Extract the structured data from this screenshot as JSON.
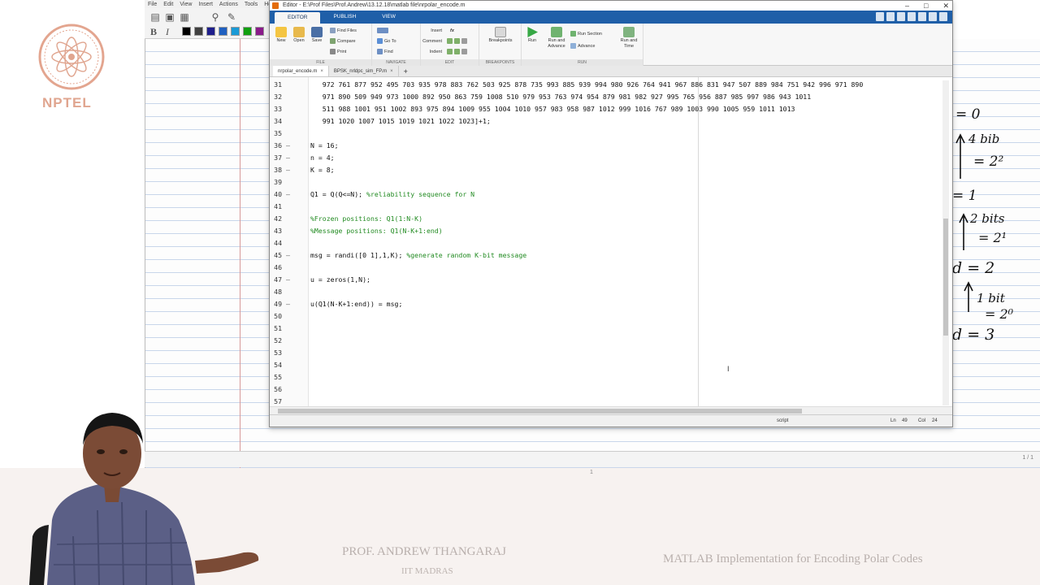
{
  "branding": {
    "logo_text": "NPTEL",
    "logo_color": "#e0a58f"
  },
  "lecture": {
    "professor": "PROF. ANDREW THANGARAJ",
    "institute": "IIT MADRAS",
    "title": "MATLAB Implementation for Encoding Polar Codes"
  },
  "journal": {
    "menu": [
      "File",
      "Edit",
      "View",
      "Insert",
      "Actions",
      "Tools",
      "He"
    ],
    "page_indicator": "1 / 1",
    "center_marker": "1",
    "pen_colors": [
      "#000000",
      "#404040",
      "#1e1e8c",
      "#2060c0",
      "#1a9ad6",
      "#10a010",
      "#8a1a8a"
    ]
  },
  "handwriting": {
    "lines": [
      "= 0",
      "4 bib",
      "= 2²",
      "= 1",
      "2 bits",
      "= 2¹",
      "d = 2",
      "1 bit",
      "= 2⁰",
      "d = 3"
    ]
  },
  "editor": {
    "title": "Editor - E:\\Prof Files\\Prof.Andrew\\13.12.18\\matlab file\\nrpolar_encode.m",
    "window_controls": [
      "–",
      "□",
      "✕"
    ],
    "ribbon_tabs": [
      "EDITOR",
      "PUBLISH",
      "VIEW"
    ],
    "ribbon": {
      "file": {
        "label": "FILE",
        "new": "New",
        "open": "Open",
        "save": "Save",
        "find_files": "Find Files",
        "compare": "Compare",
        "print": "Print"
      },
      "navigate": {
        "label": "NAVIGATE",
        "go_to": "Go To",
        "find": "Find"
      },
      "edit": {
        "label": "EDIT",
        "insert": "Insert",
        "comment": "Comment",
        "indent": "Indent",
        "fx": "fx"
      },
      "breakpoints": {
        "label": "BREAKPOINTS",
        "breakpoints": "Breakpoints"
      },
      "run": {
        "label": "RUN",
        "run": "Run",
        "run_and_advance": "Run and Advance",
        "run_section": "Run Section",
        "advance": "Advance",
        "run_and_time": "Run and Time"
      }
    },
    "file_tabs": [
      {
        "name": "nrpolar_encode.m",
        "active": true
      },
      {
        "name": "BPSK_nrldpc_sim_FP.m",
        "active": false
      }
    ],
    "new_tab": "+",
    "close_glyph": "×",
    "code_lines": [
      {
        "n": "31",
        "marker": "",
        "text": "   972 761 877 952 495 703 935 978 883 762 503 925 878 735 993 885 939 994 980 926 764 941 967 886 831 947 507 889 984 751 942 996 971 890",
        "cls": ""
      },
      {
        "n": "32",
        "marker": "",
        "text": "   971 890 509 949 973 1000 892 950 863 759 1008 510 979 953 763 974 954 879 981 982 927 995 765 956 887 985 997 986 943 1011",
        "cls": ""
      },
      {
        "n": "33",
        "marker": "",
        "text": "   511 988 1001 951 1002 893 975 894 1009 955 1004 1010 957 983 958 987 1012 999 1016 767 989 1003 990 1005 959 1011 1013",
        "cls": ""
      },
      {
        "n": "34",
        "marker": "",
        "text": "   991 1020 1007 1015 1019 1021 1022 1023]+1;",
        "cls": ""
      },
      {
        "n": "35",
        "marker": "",
        "text": "",
        "cls": ""
      },
      {
        "n": "36",
        "marker": "—",
        "text": "N = 16;",
        "cls": ""
      },
      {
        "n": "37",
        "marker": "—",
        "text": "n = 4;",
        "cls": ""
      },
      {
        "n": "38",
        "marker": "—",
        "text": "K = 8;",
        "cls": ""
      },
      {
        "n": "39",
        "marker": "",
        "text": "",
        "cls": ""
      },
      {
        "n": "40",
        "marker": "—",
        "text": "Q1 = Q(Q<=N); ",
        "comment": "%reliability sequence for N",
        "cls": ""
      },
      {
        "n": "41",
        "marker": "",
        "text": "",
        "cls": ""
      },
      {
        "n": "42",
        "marker": "",
        "text": "%Frozen positions: Q1(1:N-K)",
        "cls": "cmt"
      },
      {
        "n": "43",
        "marker": "",
        "text": "%Message positions: Q1(N-K+1:end)",
        "cls": "cmt"
      },
      {
        "n": "44",
        "marker": "",
        "text": "",
        "cls": ""
      },
      {
        "n": "45",
        "marker": "—",
        "text": "msg = randi([0 1],1,K); ",
        "comment": "%generate random K-bit message",
        "cls": ""
      },
      {
        "n": "46",
        "marker": "",
        "text": "",
        "cls": ""
      },
      {
        "n": "47",
        "marker": "—",
        "text": "u = zeros(1,N);",
        "cls": ""
      },
      {
        "n": "48",
        "marker": "",
        "text": "",
        "cls": ""
      },
      {
        "n": "49",
        "marker": "—",
        "text": "u(Q1(N-K+1:end)) = msg;",
        "cls": ""
      },
      {
        "n": "50",
        "marker": "",
        "text": "",
        "cls": ""
      },
      {
        "n": "51",
        "marker": "",
        "text": "",
        "cls": ""
      },
      {
        "n": "52",
        "marker": "",
        "text": "",
        "cls": ""
      },
      {
        "n": "53",
        "marker": "",
        "text": "",
        "cls": ""
      },
      {
        "n": "54",
        "marker": "",
        "text": "",
        "cls": ""
      },
      {
        "n": "55",
        "marker": "",
        "text": "",
        "cls": ""
      },
      {
        "n": "56",
        "marker": "",
        "text": "",
        "cls": ""
      },
      {
        "n": "57",
        "marker": "",
        "text": "",
        "cls": ""
      }
    ],
    "status": {
      "mode": "script",
      "ln_label": "Ln",
      "ln": "49",
      "col_label": "Col",
      "col": "24"
    }
  }
}
